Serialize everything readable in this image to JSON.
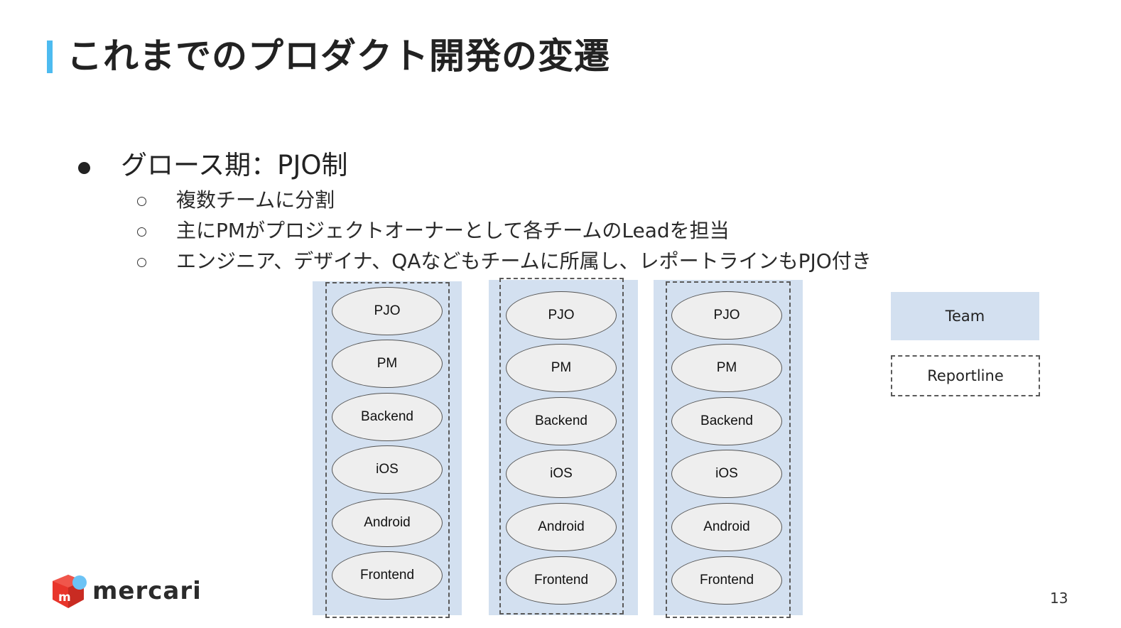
{
  "slide": {
    "title": "これまでのプロダクト開発の変遷",
    "accent_color": "#4dbbf0",
    "bullets": {
      "main": "グロース期：PJO制",
      "sub": [
        "複数チームに分割",
        "主にPMがプロジェクトオーナーとして各チームのLeadを担当",
        "エンジニア、デザイナ、QAなどもチームに所属し、レポートラインもPJO付き"
      ]
    },
    "diagram": {
      "team_color": "#d3e0f0",
      "teams": [
        {
          "members": [
            "PJO",
            "PM",
            "Backend",
            "iOS",
            "Android",
            "Frontend"
          ]
        },
        {
          "members": [
            "PJO",
            "PM",
            "Backend",
            "iOS",
            "Android",
            "Frontend"
          ]
        },
        {
          "members": [
            "PJO",
            "PM",
            "Backend",
            "iOS",
            "Android",
            "Frontend"
          ]
        }
      ],
      "legend": {
        "team": "Team",
        "reportline": "Reportline"
      }
    },
    "logo": {
      "wordmark": "mercari",
      "cube_letter": "m",
      "cube_color": "#e8352b",
      "dot_color": "#6cc3f5"
    },
    "page_number": "13"
  }
}
